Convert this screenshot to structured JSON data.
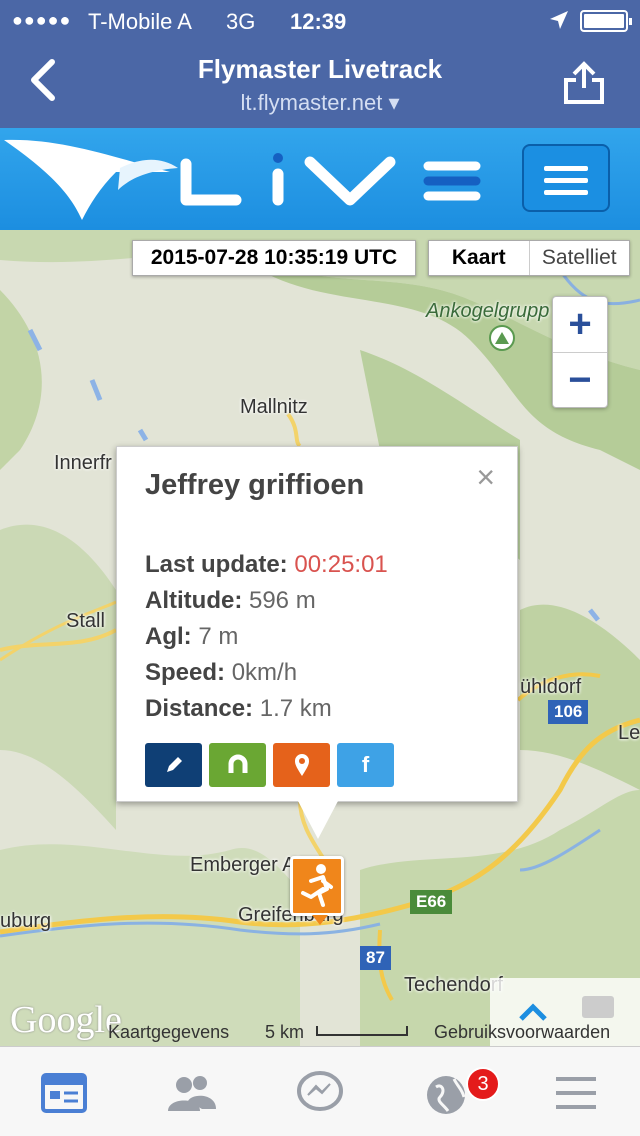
{
  "status_bar": {
    "signal": "●●●●●",
    "carrier": "T-Mobile A",
    "network": "3G",
    "time": "12:39"
  },
  "nav": {
    "title": "Flymaster Livetrack",
    "url": "lt.flymaster.net ▾"
  },
  "map": {
    "timestamp": "2015-07-28 10:35:19 UTC",
    "map_types": [
      "Kaart",
      "Satelliet"
    ],
    "active_map_type": "Kaart",
    "zoom_in": "+",
    "zoom_out": "−",
    "places": {
      "ankogel": "Ankogelgrupp",
      "mallnitz": "Mallnitz",
      "innerf": "Innerfr",
      "stall": "Stall",
      "uhldorf": "ühldorf",
      "le": "Le",
      "emberger": "Emberger Al",
      "greifenburg": "Greifenburg",
      "uburg": "uburg",
      "techendorf": "Techendorf"
    },
    "road_shields": {
      "r106": "106",
      "e66": "E66",
      "r87": "87"
    },
    "footer": {
      "logo": "Google",
      "data": "Kaartgegevens",
      "scale": "5 km",
      "terms": "Gebruiksvoorwaarden"
    }
  },
  "popup": {
    "close": "×",
    "pilot_name": "Jeffrey griffioen",
    "last_update_label": "Last update:",
    "last_update_value": "00:25:01",
    "altitude_label": "Altitude:",
    "altitude_value": "596 m",
    "agl_label": "Agl:",
    "agl_value": "7 m",
    "speed_label": "Speed:",
    "speed_value": "0km/h",
    "distance_label": "Distance:",
    "distance_value": "1.7 km",
    "facebook_glyph": "f"
  },
  "tab_bar": {
    "notifications_badge": "3"
  },
  "colors": {
    "nav_bg": "#4b67a6",
    "banner": "#1c8ee0",
    "marker": "#f0861b",
    "last_update": "#d9534f",
    "btn_edit": "#0f3f75",
    "btn_magnet": "#6aa733",
    "btn_pin": "#e5621b",
    "btn_facebook": "#3ea2e6"
  }
}
